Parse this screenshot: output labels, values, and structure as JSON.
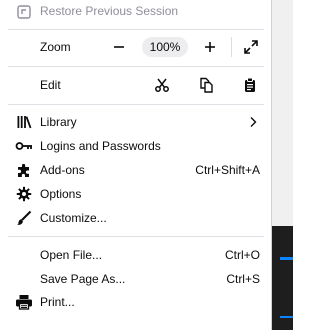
{
  "menu": {
    "restore_session": "Restore Previous Session",
    "zoom": {
      "label": "Zoom",
      "level": "100%"
    },
    "edit": {
      "label": "Edit"
    },
    "library": "Library",
    "logins": "Logins and Passwords",
    "addons": {
      "label": "Add-ons",
      "shortcut": "Ctrl+Shift+A"
    },
    "options": "Options",
    "customize": "Customize...",
    "open_file": {
      "label": "Open File...",
      "shortcut": "Ctrl+O"
    },
    "save_page": {
      "label": "Save Page As...",
      "shortcut": "Ctrl+S"
    },
    "print": "Print..."
  },
  "colors": {
    "accent_red": "#e22850",
    "accent_blue": "#0a84ff"
  }
}
